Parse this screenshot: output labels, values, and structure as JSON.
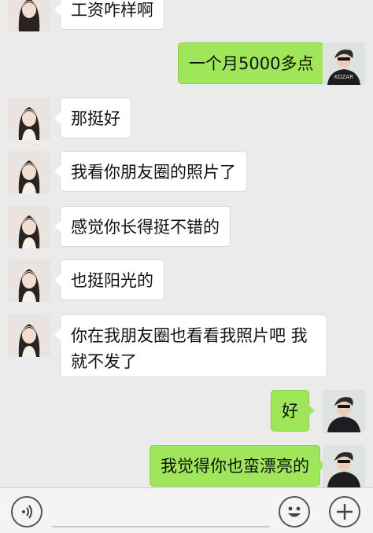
{
  "messages": [
    {
      "side": "in",
      "text": "工资咋样啊"
    },
    {
      "side": "out",
      "text": "一个月5000多点"
    },
    {
      "side": "in",
      "text": "那挺好"
    },
    {
      "side": "in",
      "text": "我看你朋友圈的照片了"
    },
    {
      "side": "in",
      "text": "感觉你长得挺不错的"
    },
    {
      "side": "in",
      "text": "也挺阳光的"
    },
    {
      "side": "in",
      "text": "你在我朋友圈也看看我照片吧 我就不发了"
    },
    {
      "side": "out",
      "text": "好"
    },
    {
      "side": "out",
      "text": "我觉得你也蛮漂亮的"
    }
  ],
  "avatar_shirt_text": "KOZAR",
  "input": {
    "value": "",
    "placeholder": ""
  },
  "icons": {
    "voice": "voice-wave-icon",
    "emoji": "smiley-icon",
    "more": "plus-icon"
  },
  "colors": {
    "background": "#ebebeb",
    "incoming_bubble": "#ffffff",
    "outgoing_bubble": "#9fe65a"
  }
}
